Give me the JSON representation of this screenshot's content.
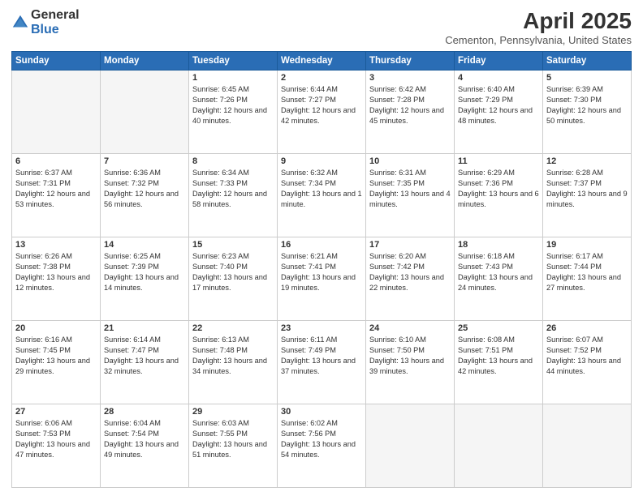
{
  "header": {
    "logo_general": "General",
    "logo_blue": "Blue",
    "title": "April 2025",
    "location": "Cementon, Pennsylvania, United States"
  },
  "days_of_week": [
    "Sunday",
    "Monday",
    "Tuesday",
    "Wednesday",
    "Thursday",
    "Friday",
    "Saturday"
  ],
  "weeks": [
    [
      {
        "day": "",
        "empty": true
      },
      {
        "day": "",
        "empty": true
      },
      {
        "day": "1",
        "sunrise": "6:45 AM",
        "sunset": "7:26 PM",
        "daylight": "12 hours and 40 minutes."
      },
      {
        "day": "2",
        "sunrise": "6:44 AM",
        "sunset": "7:27 PM",
        "daylight": "12 hours and 42 minutes."
      },
      {
        "day": "3",
        "sunrise": "6:42 AM",
        "sunset": "7:28 PM",
        "daylight": "12 hours and 45 minutes."
      },
      {
        "day": "4",
        "sunrise": "6:40 AM",
        "sunset": "7:29 PM",
        "daylight": "12 hours and 48 minutes."
      },
      {
        "day": "5",
        "sunrise": "6:39 AM",
        "sunset": "7:30 PM",
        "daylight": "12 hours and 50 minutes."
      }
    ],
    [
      {
        "day": "6",
        "sunrise": "6:37 AM",
        "sunset": "7:31 PM",
        "daylight": "12 hours and 53 minutes."
      },
      {
        "day": "7",
        "sunrise": "6:36 AM",
        "sunset": "7:32 PM",
        "daylight": "12 hours and 56 minutes."
      },
      {
        "day": "8",
        "sunrise": "6:34 AM",
        "sunset": "7:33 PM",
        "daylight": "12 hours and 58 minutes."
      },
      {
        "day": "9",
        "sunrise": "6:32 AM",
        "sunset": "7:34 PM",
        "daylight": "13 hours and 1 minute."
      },
      {
        "day": "10",
        "sunrise": "6:31 AM",
        "sunset": "7:35 PM",
        "daylight": "13 hours and 4 minutes."
      },
      {
        "day": "11",
        "sunrise": "6:29 AM",
        "sunset": "7:36 PM",
        "daylight": "13 hours and 6 minutes."
      },
      {
        "day": "12",
        "sunrise": "6:28 AM",
        "sunset": "7:37 PM",
        "daylight": "13 hours and 9 minutes."
      }
    ],
    [
      {
        "day": "13",
        "sunrise": "6:26 AM",
        "sunset": "7:38 PM",
        "daylight": "13 hours and 12 minutes."
      },
      {
        "day": "14",
        "sunrise": "6:25 AM",
        "sunset": "7:39 PM",
        "daylight": "13 hours and 14 minutes."
      },
      {
        "day": "15",
        "sunrise": "6:23 AM",
        "sunset": "7:40 PM",
        "daylight": "13 hours and 17 minutes."
      },
      {
        "day": "16",
        "sunrise": "6:21 AM",
        "sunset": "7:41 PM",
        "daylight": "13 hours and 19 minutes."
      },
      {
        "day": "17",
        "sunrise": "6:20 AM",
        "sunset": "7:42 PM",
        "daylight": "13 hours and 22 minutes."
      },
      {
        "day": "18",
        "sunrise": "6:18 AM",
        "sunset": "7:43 PM",
        "daylight": "13 hours and 24 minutes."
      },
      {
        "day": "19",
        "sunrise": "6:17 AM",
        "sunset": "7:44 PM",
        "daylight": "13 hours and 27 minutes."
      }
    ],
    [
      {
        "day": "20",
        "sunrise": "6:16 AM",
        "sunset": "7:45 PM",
        "daylight": "13 hours and 29 minutes."
      },
      {
        "day": "21",
        "sunrise": "6:14 AM",
        "sunset": "7:47 PM",
        "daylight": "13 hours and 32 minutes."
      },
      {
        "day": "22",
        "sunrise": "6:13 AM",
        "sunset": "7:48 PM",
        "daylight": "13 hours and 34 minutes."
      },
      {
        "day": "23",
        "sunrise": "6:11 AM",
        "sunset": "7:49 PM",
        "daylight": "13 hours and 37 minutes."
      },
      {
        "day": "24",
        "sunrise": "6:10 AM",
        "sunset": "7:50 PM",
        "daylight": "13 hours and 39 minutes."
      },
      {
        "day": "25",
        "sunrise": "6:08 AM",
        "sunset": "7:51 PM",
        "daylight": "13 hours and 42 minutes."
      },
      {
        "day": "26",
        "sunrise": "6:07 AM",
        "sunset": "7:52 PM",
        "daylight": "13 hours and 44 minutes."
      }
    ],
    [
      {
        "day": "27",
        "sunrise": "6:06 AM",
        "sunset": "7:53 PM",
        "daylight": "13 hours and 47 minutes."
      },
      {
        "day": "28",
        "sunrise": "6:04 AM",
        "sunset": "7:54 PM",
        "daylight": "13 hours and 49 minutes."
      },
      {
        "day": "29",
        "sunrise": "6:03 AM",
        "sunset": "7:55 PM",
        "daylight": "13 hours and 51 minutes."
      },
      {
        "day": "30",
        "sunrise": "6:02 AM",
        "sunset": "7:56 PM",
        "daylight": "13 hours and 54 minutes."
      },
      {
        "day": "",
        "empty": true
      },
      {
        "day": "",
        "empty": true
      },
      {
        "day": "",
        "empty": true
      }
    ]
  ]
}
